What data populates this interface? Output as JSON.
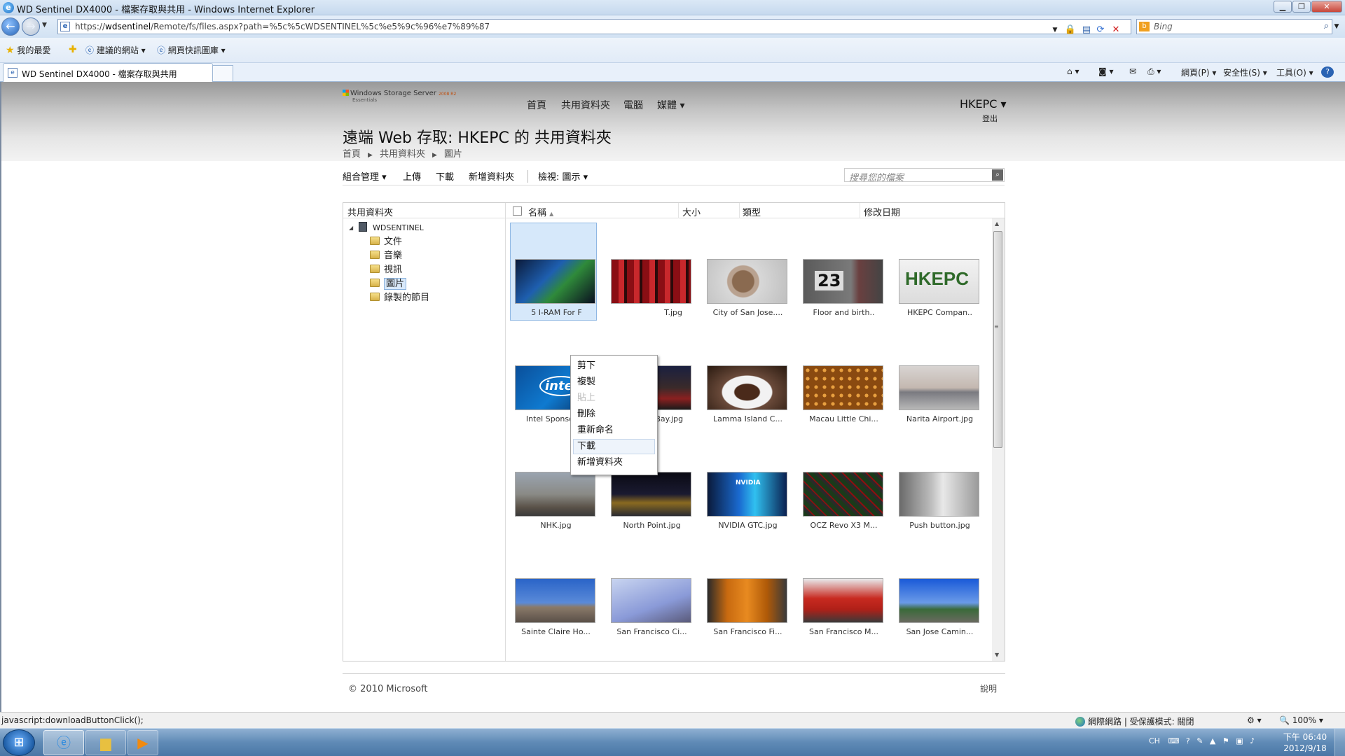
{
  "window": {
    "title": "WD Sentinel DX4000 - 檔案存取與共用 - Windows Internet Explorer",
    "min_label": "▁",
    "max_label": "❐",
    "close_label": "✕"
  },
  "address": {
    "url_prefix": "https://",
    "url_host": "wdsentinel",
    "url_path": "/Remote/fs/files.aspx?path=%5c%5cWDSENTINEL%5c%e5%9c%96%e7%89%87",
    "search_placeholder": "Bing"
  },
  "favorites": {
    "favorites_label": "我的最愛",
    "suggested_label": "建議的網站 ▾",
    "gallery_label": "網頁快訊圖庫 ▾"
  },
  "tab": {
    "title": "WD Sentinel DX4000 - 檔案存取與共用"
  },
  "commands": {
    "page": "網頁(P) ▾",
    "safety": "安全性(S) ▾",
    "tools": "工具(O) ▾",
    "help": "?"
  },
  "site": {
    "logo_text": "Windows Storage Server",
    "logo_version": "2008 R2",
    "logo_sub": "Essentials",
    "nav": [
      "首頁",
      "共用資料夾",
      "電腦",
      "媒體 ▾"
    ],
    "user": "HKEPC ▾",
    "logout": "登出",
    "title": "遠端 Web 存取: HKEPC 的 共用資料夾",
    "breadcrumb": [
      "首頁",
      "共用資料夾",
      "圖片"
    ],
    "breadcrumb_sep": "▶"
  },
  "toolbar": {
    "organize": "組合管理 ▾",
    "upload": "上傳",
    "download": "下載",
    "new_folder": "新增資料夾",
    "view": "檢視: 圖示 ▾",
    "search_placeholder": "搜尋您的檔案"
  },
  "tree": {
    "header": "共用資料夾",
    "root": "WDSENTINEL",
    "items": [
      "文件",
      "音樂",
      "視訊",
      "圖片",
      "錄製的節目"
    ],
    "selected": "圖片"
  },
  "list": {
    "columns": [
      "名稱",
      "大小",
      "類型",
      "修改日期"
    ],
    "sort_indicator": "▲",
    "files": [
      "5 I-RAM For F",
      "T.jpg",
      "City of San Jose....",
      "Floor and birth..",
      "HKEPC Compan..",
      "Intel Sponsors..",
      "Kowloon Bay.jpg",
      "Lamma Island C...",
      "Macau Little Chi...",
      "Narita Airport.jpg",
      "NHK.jpg",
      "North Point.jpg",
      "NVIDIA GTC.jpg",
      "OCZ Revo X3 M...",
      "Push button.jpg",
      "Sainte Claire Ho...",
      "San Francisco Ci...",
      "San Francisco Fi...",
      "San Francisco M...",
      "San Jose Camin..."
    ],
    "thumb_text": {
      "floor": "23",
      "hkepc": "HKEPC",
      "intel": "intel",
      "nvidia": "NVIDIA"
    }
  },
  "context_menu": {
    "items": [
      "剪下",
      "複製",
      "貼上",
      "刪除",
      "重新命名",
      "下載",
      "新增資料夾"
    ],
    "disabled": [
      "貼上"
    ],
    "highlighted": "下載"
  },
  "footer": {
    "copyright": "© 2010 Microsoft",
    "help": "說明"
  },
  "status": {
    "text": "javascript:downloadButtonClick();",
    "zone": "網際網路 | 受保護模式: 關閉",
    "zoom": "100%"
  },
  "taskbar": {
    "lang": "CH",
    "time": "下午 06:40",
    "date": "2012/9/18"
  }
}
